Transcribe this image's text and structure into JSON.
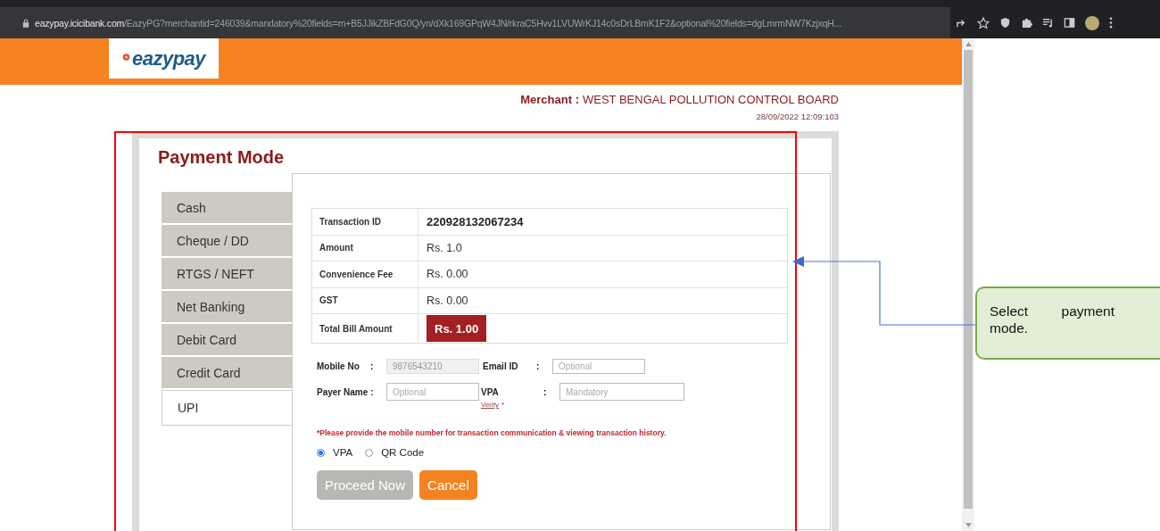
{
  "browser": {
    "url_host": "eazypay.icicibank.com",
    "url_path": "/EazyPG?merchantid=246039&mandatory%20fields=m+B5JJikZBFdG0Q/yn/dXk169GPqW4JN/rkraC5Hvv1LVUWrKJ14c0sDrLBmK1F2&optional%20fields=dgLmrmNW7KzjxqH..."
  },
  "logo": {
    "text": "eazypay"
  },
  "merchant": {
    "label": "Merchant :",
    "name": "WEST BENGAL POLLUTION CONTROL BOARD",
    "timestamp": "28/09/2022 12:09:103"
  },
  "title": "Payment Mode",
  "tabs": [
    {
      "label": "Cash",
      "selected": false
    },
    {
      "label": "Cheque / DD",
      "selected": false
    },
    {
      "label": "RTGS / NEFT",
      "selected": false
    },
    {
      "label": "Net Banking",
      "selected": false
    },
    {
      "label": "Debit Card",
      "selected": false
    },
    {
      "label": "Credit Card",
      "selected": false
    },
    {
      "label": "UPI",
      "selected": true
    }
  ],
  "summary": [
    {
      "label": "Transaction ID",
      "value": "220928132067234",
      "kind": "id"
    },
    {
      "label": "Amount",
      "value": "Rs. 1.0",
      "kind": "plain"
    },
    {
      "label": "Convenience Fee",
      "value": "Rs. 0.00",
      "kind": "plain"
    },
    {
      "label": "GST",
      "value": "Rs. 0.00",
      "kind": "plain"
    },
    {
      "label": "Total Bill Amount",
      "value": "Rs. 1.00",
      "kind": "total"
    }
  ],
  "form": {
    "mobile": {
      "label": "Mobile No",
      "colon": ":",
      "value": "9876543210",
      "disabled": true
    },
    "email": {
      "label": "Email ID",
      "colon": ":",
      "placeholder": "Optional"
    },
    "payer": {
      "label": "Payer Name :",
      "placeholder": "Optional"
    },
    "vpa": {
      "label": "VPA",
      "colon": ":",
      "placeholder": "Mandatory",
      "verify": "Verify",
      "required": "*"
    }
  },
  "notice": "*Please provide the mobile number for transaction communication & viewing transaction history.",
  "options": [
    {
      "label": "VPA",
      "selected": true
    },
    {
      "label": "QR Code",
      "selected": false
    }
  ],
  "buttons": {
    "proceed": {
      "label": "Proceed Now",
      "disabled": true
    },
    "cancel": {
      "label": "Cancel"
    }
  },
  "callout": "Select payment mode."
}
